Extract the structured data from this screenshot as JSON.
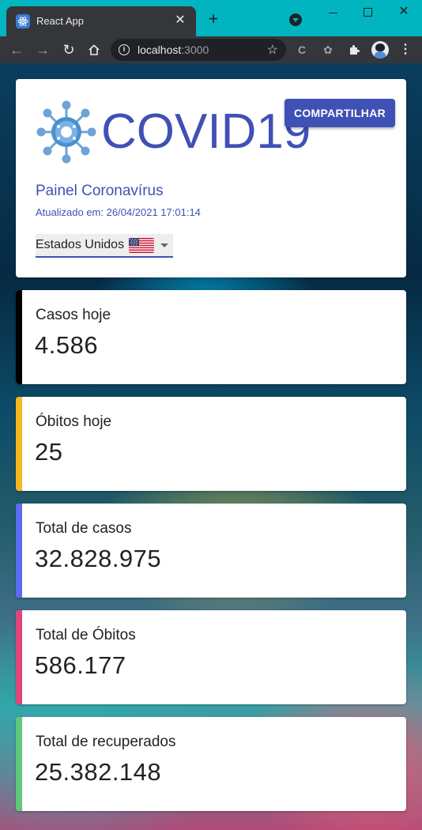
{
  "browser": {
    "tab_title": "React App",
    "tab_close": "✕",
    "new_tab": "+",
    "url_host": "localhost",
    "url_port": ":3000",
    "window_close": "✕"
  },
  "header": {
    "logo_text": "COVID19",
    "share_label": "COMPARTILHAR",
    "panel_title": "Painel Coronavírus",
    "updated_prefix": "Atualizado em:",
    "updated_value": "26/04/2021 17:01:14",
    "country_label": "Estados Unidos",
    "flag_icon": "us-flag-icon"
  },
  "stats": [
    {
      "label": "Casos hoje",
      "value": "4.586",
      "color": "#000000"
    },
    {
      "label": "Óbitos hoje",
      "value": "25",
      "color": "#f5b820"
    },
    {
      "label": "Total de casos",
      "value": "32.828.975",
      "color": "#5c6bf0"
    },
    {
      "label": "Total de Óbitos",
      "value": "586.177",
      "color": "#e0447a"
    },
    {
      "label": "Total de recuperados",
      "value": "25.382.148",
      "color": "#5ec878"
    }
  ],
  "colors": {
    "primary": "#3f51b5",
    "titlebar": "#00b5bf",
    "toolbar": "#35363a"
  }
}
